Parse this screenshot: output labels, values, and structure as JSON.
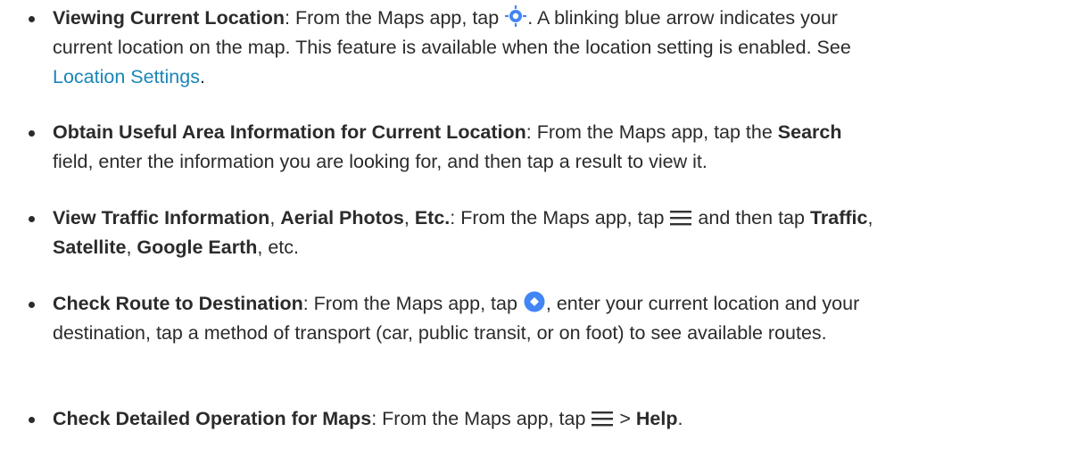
{
  "items": [
    {
      "title": "Viewing Current Location",
      "line1_a": ": From the Maps app, tap ",
      "line1_b": ". A blinking blue arrow indicates your",
      "line2": "current location on the map. This feature is available when the location setting is enabled. See",
      "link": "Location Settings",
      "end": ".",
      "icon": "my-location-icon"
    },
    {
      "title": "Obtain Useful Area Information for Current Location",
      "line1_a": ": From the Maps app, tap the ",
      "bold1": "Search",
      "line2": "field, enter the information you are looking for, and then tap a result to view it."
    },
    {
      "title_a": "View Traffic Information",
      "sep1": ", ",
      "title_b": "Aerial Photos",
      "sep2": ", ",
      "title_c": "Etc.",
      "line1_a": ": From the Maps app, tap ",
      "line1_b": " and then tap ",
      "bold1": "Traffic",
      "sep3": ",",
      "bold2": "Satellite",
      "sep4": ", ",
      "bold3": "Google Earth",
      "end": ", etc.",
      "icon": "menu-icon"
    },
    {
      "title": "Check Route to Destination",
      "line1_a": ": From the Maps app, tap ",
      "line1_b": ", enter your current location and your",
      "line2": "destination, tap a method of transport (car, public transit, or on foot) to see available routes.",
      "icon": "directions-icon"
    },
    {
      "title": "Check Detailed Operation for Maps",
      "line1_a": ": From the Maps app, tap ",
      "line1_b": " > ",
      "bold1": "Help",
      "end": ".",
      "icon": "menu-icon"
    }
  ],
  "colors": {
    "text": "#2b2b2b",
    "link": "#1a86b8",
    "icon_blue": "#4285f4"
  }
}
